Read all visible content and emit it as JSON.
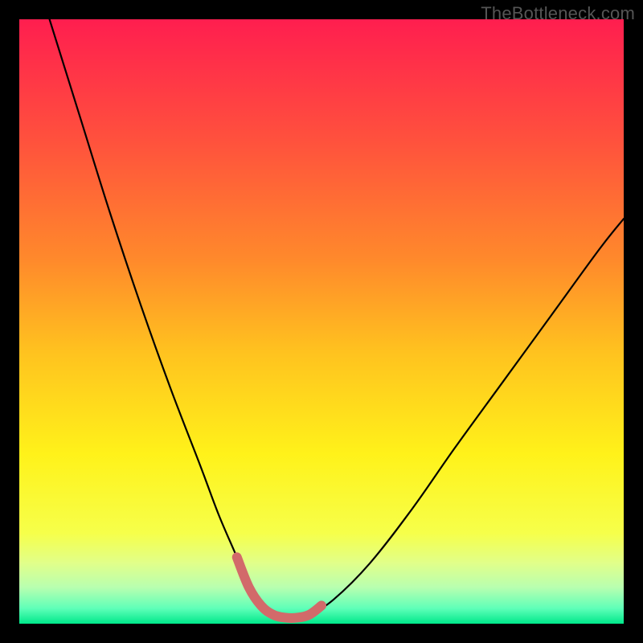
{
  "watermark": "TheBottleneck.com",
  "chart_data": {
    "type": "line",
    "title": "",
    "xlabel": "",
    "ylabel": "",
    "xlim": [
      0,
      100
    ],
    "ylim": [
      0,
      100
    ],
    "grid": false,
    "legend": false,
    "background_gradient": {
      "stops": [
        {
          "pos": 0.0,
          "color": "#ff1e4f"
        },
        {
          "pos": 0.2,
          "color": "#ff513d"
        },
        {
          "pos": 0.4,
          "color": "#ff8a2b"
        },
        {
          "pos": 0.55,
          "color": "#ffc21f"
        },
        {
          "pos": 0.72,
          "color": "#fff21a"
        },
        {
          "pos": 0.85,
          "color": "#f6ff4a"
        },
        {
          "pos": 0.9,
          "color": "#e1ff8a"
        },
        {
          "pos": 0.94,
          "color": "#b8ffb0"
        },
        {
          "pos": 0.975,
          "color": "#5effb8"
        },
        {
          "pos": 1.0,
          "color": "#00e88a"
        }
      ]
    },
    "series": [
      {
        "name": "bottleneck-curve",
        "x": [
          5,
          10,
          15,
          20,
          25,
          30,
          33,
          36,
          38,
          40,
          42,
          44,
          46,
          48,
          52,
          58,
          65,
          72,
          80,
          88,
          96,
          100
        ],
        "y": [
          100,
          84,
          68,
          53,
          39,
          26,
          18,
          11,
          6,
          3,
          1.5,
          1,
          1,
          1.5,
          4,
          10,
          19,
          29,
          40,
          51,
          62,
          67
        ]
      }
    ],
    "highlight": {
      "name": "optimal-zone",
      "color": "#d26a6a",
      "x": [
        36,
        38,
        40,
        42,
        44,
        46,
        48,
        50
      ],
      "y": [
        11,
        6,
        3,
        1.5,
        1,
        1,
        1.5,
        3
      ]
    }
  }
}
